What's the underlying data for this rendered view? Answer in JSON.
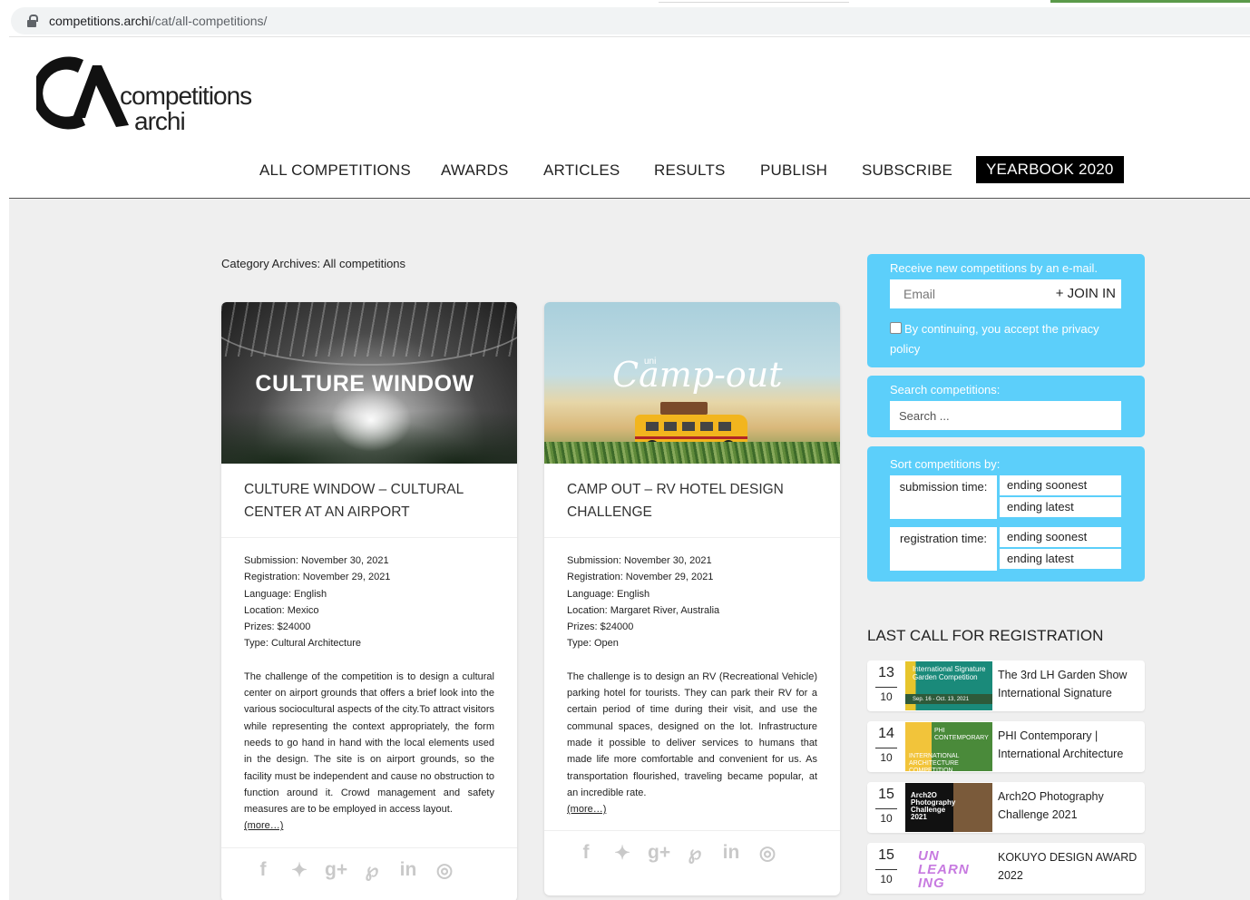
{
  "browser": {
    "url_host": "competitions.archi",
    "url_path": "/cat/all-competitions/"
  },
  "logo": {
    "line1": "competitions",
    "line2": "archi"
  },
  "nav": {
    "items": [
      "ALL COMPETITIONS",
      "AWARDS",
      "ARTICLES",
      "RESULTS",
      "PUBLISH",
      "SUBSCRIBE"
    ],
    "yearbook": "YEARBOOK 2020"
  },
  "category_title": "Category Archives: All competitions",
  "cards": [
    {
      "image_text": "CULTURE WINDOW",
      "title": "CULTURE WINDOW – CULTURAL CENTER AT AN AIRPORT",
      "meta": [
        "Submission: November 30, 2021",
        "Registration: November 29, 2021",
        "Language: English",
        "Location: Mexico",
        "Prizes: $24000",
        "Type: Cultural Architecture"
      ],
      "description": "The challenge of the competition is to design a cultural center on airport grounds that offers a brief look into the various sociocultural aspects of the city.To attract visitors while representing the context appropriately, the form needs to go hand in hand with the local elements used in the design. The site is on airport grounds, so the facility must be independent and cause no obstruction to function around it. Crowd management and safety measures are to be employed in access layout.",
      "more": "(more…)"
    },
    {
      "image_text_small": "uni",
      "image_text": "Camp-out",
      "title": "CAMP OUT – RV HOTEL DESIGN CHALLENGE",
      "meta": [
        "Submission: November 30, 2021",
        "Registration: November 29, 2021",
        "Language: English",
        "Location: Margaret River, Australia",
        "Prizes: $24000",
        "Type: Open"
      ],
      "description": "The challenge is to design an RV (Recreational Vehicle) parking hotel for tourists. They can park their RV for a certain period of time during their visit, and use the communal spaces, designed on the lot. Infrastructure made it possible to deliver services to humans that made life more comfortable and convenient for us. As transportation flourished, traveling became popular, at an incredible rate.",
      "more": "(more…)"
    }
  ],
  "social_icons": [
    {
      "name": "facebook-icon",
      "glyph": "f"
    },
    {
      "name": "twitter-icon",
      "glyph": "🐦"
    },
    {
      "name": "google-plus-icon",
      "glyph": "g+"
    },
    {
      "name": "pinterest-icon",
      "glyph": "℘"
    },
    {
      "name": "linkedin-icon",
      "glyph": "in"
    },
    {
      "name": "instagram-icon",
      "glyph": "◎"
    }
  ],
  "sidebar": {
    "subscribe": {
      "caption": "Receive new competitions by an e-mail.",
      "email_placeholder": "Email",
      "join_label": "+ JOIN IN",
      "consent": "By continuing, you accept the privacy policy"
    },
    "search": {
      "caption": "Search competitions:",
      "placeholder": "Search ..."
    },
    "sort": {
      "caption": "Sort competitions by:",
      "rows": [
        {
          "label": "submission time:",
          "options": [
            "ending soonest",
            "ending latest"
          ]
        },
        {
          "label": "registration time:",
          "options": [
            "ending soonest",
            "ending latest"
          ]
        }
      ]
    },
    "last_call": {
      "heading": "LAST CALL FOR REGISTRATION",
      "items": [
        {
          "day": "13",
          "month": "10",
          "title": "The 3rd LH Garden Show International Signature",
          "thumb_text": "International Signature Garden Competition",
          "thumb_sub": "Sep. 16 - Oct. 13, 2021"
        },
        {
          "day": "14",
          "month": "10",
          "title": "PHI Contemporary | International Architecture",
          "thumb_text": "PHI CONTEMPORARY",
          "thumb_sub": "INTERNATIONAL ARCHITECTURE COMPETITION"
        },
        {
          "day": "15",
          "month": "10",
          "title": "Arch2O Photography Challenge 2021",
          "thumb_text": "Arch2O Photography Challenge 2021",
          "thumb_sub": ""
        },
        {
          "day": "15",
          "month": "10",
          "title": "KOKUYO DESIGN AWARD 2022",
          "thumb_text": "UN LEARN ING",
          "thumb_sub": ""
        }
      ]
    }
  }
}
